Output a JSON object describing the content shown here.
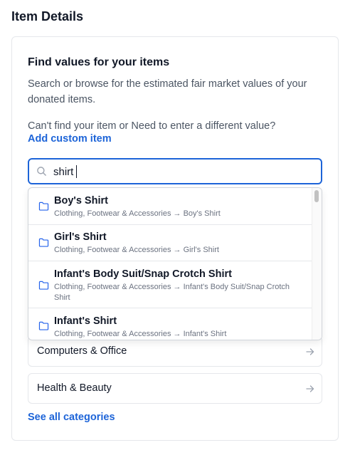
{
  "page": {
    "section_title": "Item Details"
  },
  "card": {
    "heading": "Find values for your items",
    "description": "Search or browse for the estimated fair market values of your donated items.",
    "cant_find": "Can't find your item or Need to enter a different value?",
    "add_custom_link": "Add custom item",
    "see_all_link": "See all categories"
  },
  "search": {
    "value": "shirt",
    "icon": "search-icon"
  },
  "dropdown": {
    "items": [
      {
        "title": "Boy's Shirt",
        "path": "Clothing, Footwear & Accessories → Boy's Shirt",
        "icon": "folder-icon"
      },
      {
        "title": "Girl's Shirt",
        "path": "Clothing, Footwear & Accessories → Girl's Shirt",
        "icon": "folder-icon"
      },
      {
        "title": "Infant's Body Suit/Snap Crotch Shirt",
        "path": "Clothing, Footwear & Accessories → Infant's Body Suit/Snap Crotch Shirt",
        "icon": "folder-icon"
      },
      {
        "title": "Infant's Shirt",
        "path": "Clothing, Footwear & Accessories → Infant's Shirt",
        "icon": "folder-icon"
      }
    ]
  },
  "categories": [
    {
      "label": "Computers & Office",
      "icon": "arrow-right-icon"
    },
    {
      "label": "Health & Beauty",
      "icon": "arrow-right-icon"
    }
  ],
  "colors": {
    "accent": "#1d64d8",
    "border": "#e5e7eb",
    "muted_text": "#6b7280",
    "folder_icon": "#2563eb"
  }
}
